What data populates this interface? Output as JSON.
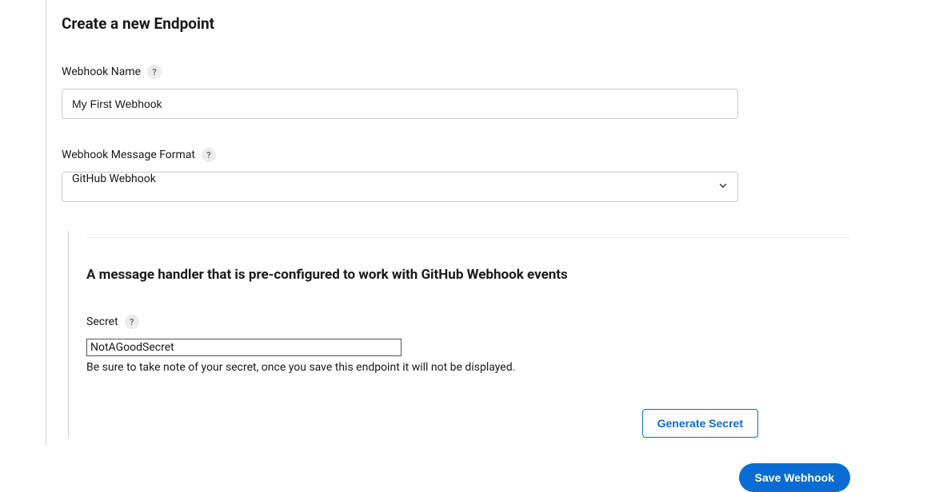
{
  "page": {
    "title": "Create a new Endpoint"
  },
  "webhookName": {
    "label": "Webhook Name",
    "value": "My First Webhook",
    "help": "?"
  },
  "messageFormat": {
    "label": "Webhook Message Format",
    "value": "GitHub Webhook",
    "help": "?"
  },
  "handler": {
    "title": "A message handler that is pre-configured to work with GitHub Webhook events",
    "secretLabel": "Secret",
    "secretHelp": "?",
    "secretValue": "NotAGoodSecret",
    "note": "Be sure to take note of your secret, once you save this endpoint it will not be displayed.",
    "generateButton": "Generate Secret"
  },
  "actions": {
    "save": "Save Webhook"
  }
}
